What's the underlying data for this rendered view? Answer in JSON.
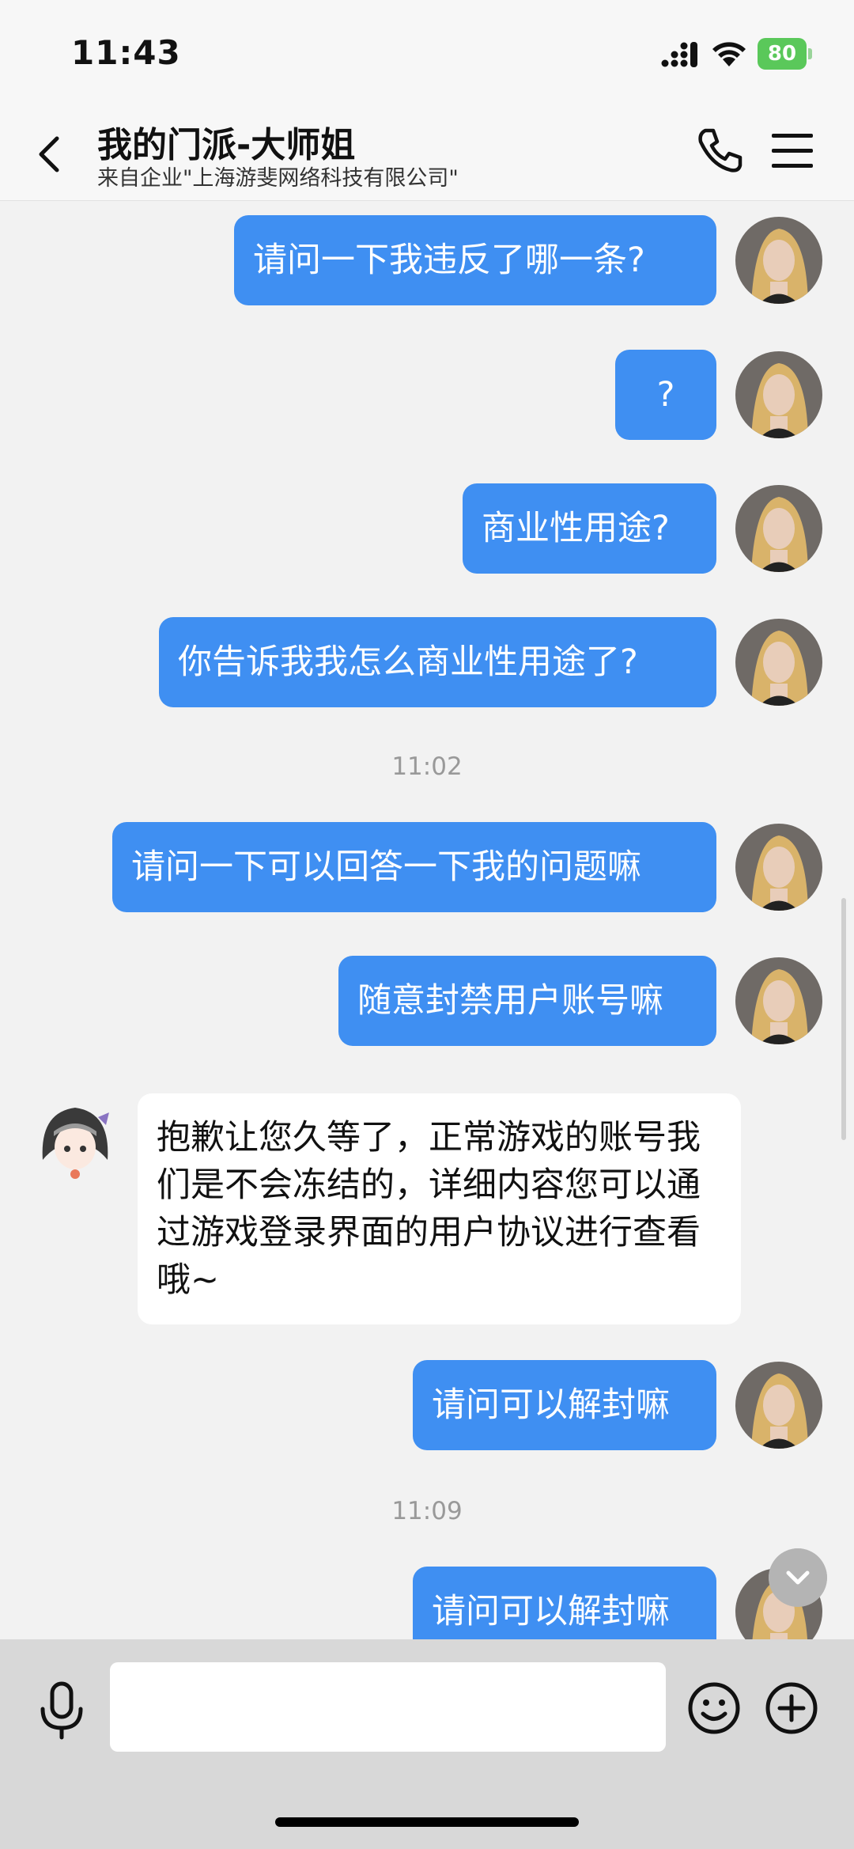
{
  "status_bar": {
    "time": "11:43",
    "battery": "80"
  },
  "header": {
    "title": "我的门派-大师姐",
    "subtitle": "来自企业\"上海游斐网络科技有限公司\""
  },
  "messages": [
    {
      "text": "请问一下我违反了哪一条?"
    },
    {
      "text": "?"
    },
    {
      "text": "商业性用途?"
    },
    {
      "text": "你告诉我我怎么商业性用途了?"
    },
    {
      "text": "11:02"
    },
    {
      "text": "请问一下可以回答一下我的问题嘛"
    },
    {
      "text": "随意封禁用户账号嘛"
    },
    {
      "text": "抱歉让您久等了，正常游戏的账号我们是不会冻结的，详细内容您可以通过游戏登录界面的用户协议进行查看哦~"
    },
    {
      "text": "请问可以解封嘛"
    },
    {
      "text": "11:09"
    },
    {
      "text": "请问可以解封嘛"
    }
  ],
  "input": {
    "value": "",
    "placeholder": ""
  },
  "colors": {
    "outgoing_bubble": "#3f8ff2",
    "incoming_bubble": "#ffffff",
    "chat_background": "#f2f2f2",
    "input_bar": "#d8d8d8"
  },
  "icons": [
    "back-icon",
    "phone-icon",
    "menu-icon",
    "mic-icon",
    "emoji-icon",
    "plus-icon",
    "chevron-down-icon"
  ]
}
